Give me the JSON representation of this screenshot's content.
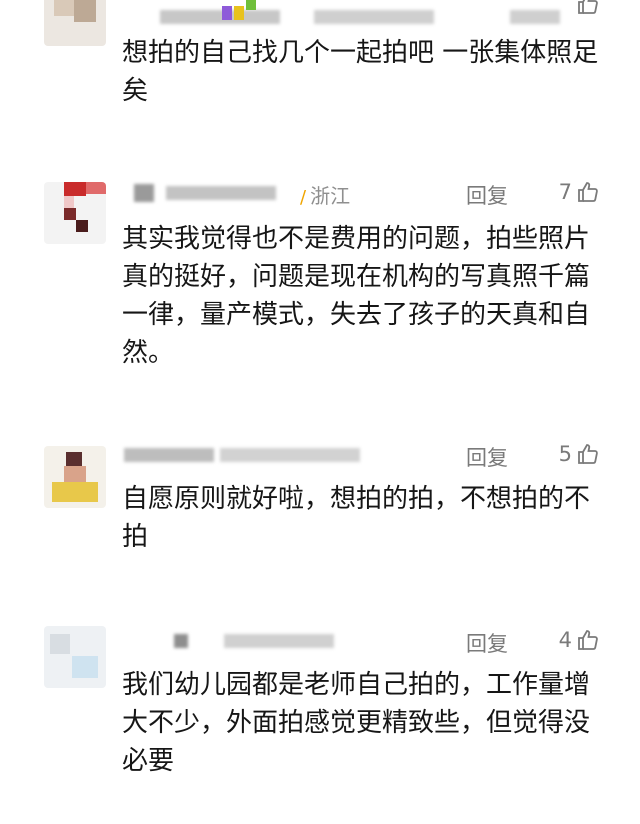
{
  "comments": [
    {
      "location": "",
      "reply_label": "",
      "likes": "",
      "text": "想拍的自己找几个一起拍吧 一张集体照足矣"
    },
    {
      "location": "浙江",
      "reply_label": "回复",
      "likes": "7",
      "text": "其实我觉得也不是费用的问题，拍些照片真的挺好，问题是现在机构的写真照千篇一律，量产模式，失去了孩子的天真和自然。"
    },
    {
      "location": "",
      "reply_label": "回复",
      "likes": "5",
      "text": "自愿原则就好啦，想拍的拍，不想拍的不拍"
    },
    {
      "location": "",
      "reply_label": "回复",
      "likes": "4",
      "text": "我们幼儿园都是老师自己拍的，工作量增大不少，外面拍感觉更精致些，但觉得没必要"
    }
  ],
  "icons": {
    "like": "thumbs-up-icon",
    "location": "location-mark-icon"
  },
  "colors": {
    "text": "#161616",
    "meta": "#7a7a7a",
    "location_mark": "#f0a500",
    "background": "#ffffff"
  }
}
